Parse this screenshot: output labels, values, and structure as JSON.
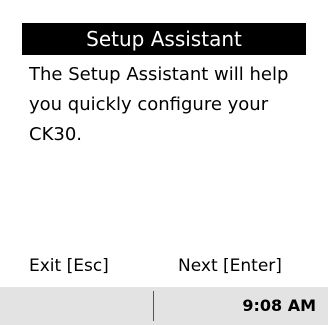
{
  "dialog": {
    "title": "Setup Assistant",
    "lines": [
      "The Setup Assistant will help",
      "you quickly configure your",
      "CK30."
    ]
  },
  "softkeys": {
    "left": "Exit [Esc]",
    "right": "Next [Enter]"
  },
  "taskbar": {
    "time": "9:08 AM"
  },
  "colors": {
    "title_bg": "#000000",
    "title_fg": "#ffffff",
    "taskbar_bg": "#e3e3e3"
  }
}
